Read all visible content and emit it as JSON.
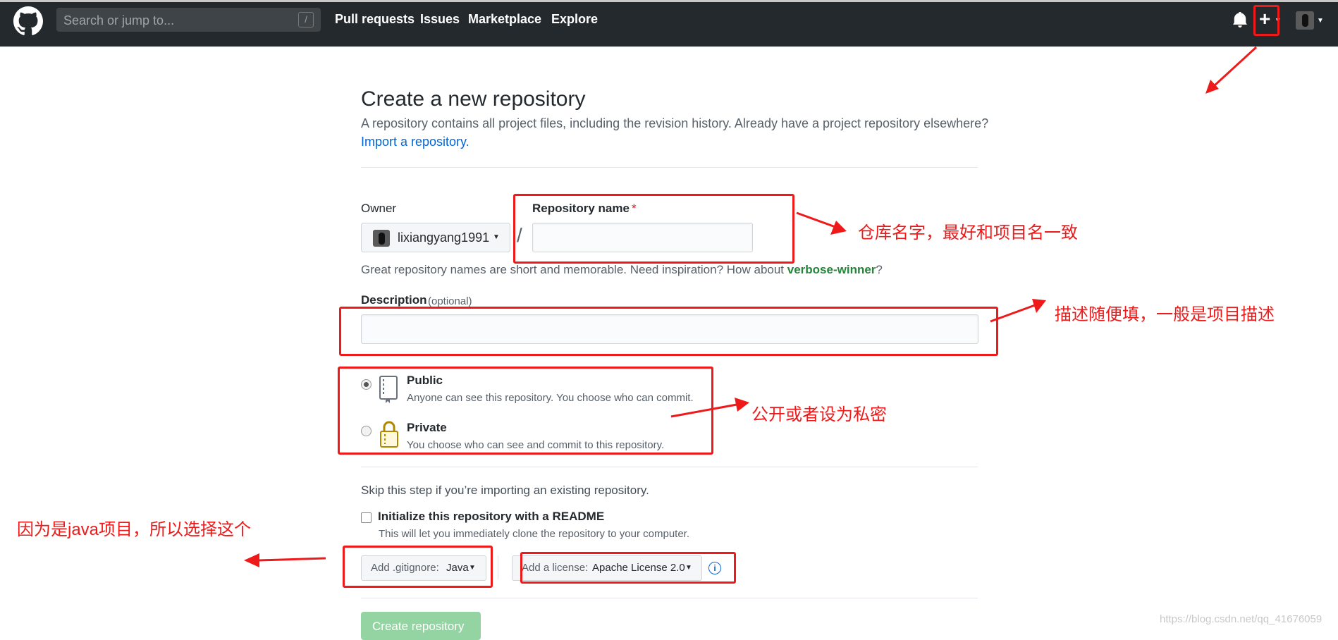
{
  "header": {
    "search_placeholder": "Search or jump to...",
    "search_shortcut": "/",
    "nav": [
      "Pull requests",
      "Issues",
      "Marketplace",
      "Explore"
    ],
    "plus_label": "+"
  },
  "form": {
    "title": "Create a new repository",
    "intro": "A repository contains all project files, including the revision history. Already have a project repository elsewhere?",
    "import_link": "Import a repository.",
    "owner_label": "Owner",
    "owner_value": "lixiangyang1991",
    "slash": "/",
    "repo_name_label": "Repository name",
    "required_mark": "*",
    "repo_name_value": "",
    "hint_prefix": "Great repository names are short and memorable. Need inspiration? How about ",
    "hint_suggestion": "verbose-winner",
    "hint_suffix": "?",
    "description_label": "Description",
    "description_optional": "(optional)",
    "description_value": "",
    "public_title": "Public",
    "public_desc": "Anyone can see this repository. You choose who can commit.",
    "private_title": "Private",
    "private_desc": "You choose who can see and commit to this repository.",
    "skip_text": "Skip this step if you’re importing an existing repository.",
    "init_title": "Initialize this repository with a README",
    "init_desc": "This will let you immediately clone the repository to your computer.",
    "gitignore_prefix": "Add .gitignore:",
    "gitignore_value": "Java",
    "license_prefix": "Add a license:",
    "license_value": "Apache License 2.0",
    "create_label": "Create repository",
    "visibility_selected": "public",
    "readme_checked": false
  },
  "annotations": {
    "repo_name": "仓库名字，最好和项目名一致",
    "description": "描述随便填，一般是项目描述",
    "visibility": "公开或者设为私密",
    "gitignore": "因为是java项目，所以选择这个"
  },
  "watermark": "https://blog.csdn.net/qq_41676059",
  "colors": {
    "header_bg": "#24292e",
    "link": "#0366d6",
    "annotation_red": "#ee1a1a",
    "create_button": "#94d3a2",
    "suggestion_green": "#22863a"
  }
}
